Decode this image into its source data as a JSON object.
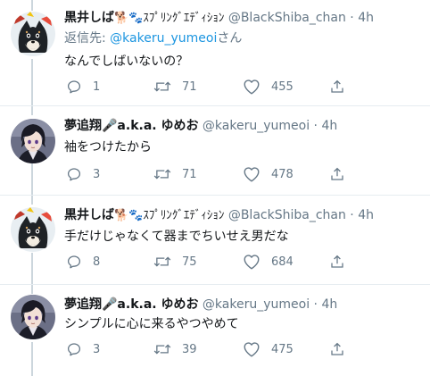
{
  "tweets": [
    {
      "name": "黒井しば",
      "badge": "🐕🐾ｽﾌﾟﾘﾝｸﾞｴﾃﾞｨｼｮﾝ",
      "handle": "@BlackShiba_chan",
      "dot": "·",
      "time": "4h",
      "replying_prefix": "返信先: ",
      "replying_to": "@kakeru_yumeoi",
      "replying_suffix": "さん",
      "text": "なんでしばいないの？",
      "replies": "1",
      "retweets": "71",
      "likes": "455",
      "avatar": "shiba-avatar"
    },
    {
      "name": "夢追翔🎤a.k.a. ゆめお",
      "handle": "@kakeru_yumeoi",
      "dot": "·",
      "time": "4h",
      "text": "袖をつけたから",
      "replies": "3",
      "retweets": "71",
      "likes": "478",
      "avatar": "dark-haired-character-avatar"
    },
    {
      "name": "黒井しば",
      "badge": "🐕🐾ｽﾌﾟﾘﾝｸﾞｴﾃﾞｨｼｮﾝ",
      "handle": "@BlackShiba_chan",
      "dot": "·",
      "time": "4h",
      "text": "手だけじゃなくて器までちいせえ男だな",
      "replies": "8",
      "retweets": "75",
      "likes": "684",
      "avatar": "shiba-avatar"
    },
    {
      "name": "夢追翔🎤a.k.a. ゆめお",
      "handle": "@kakeru_yumeoi",
      "dot": "·",
      "time": "4h",
      "text": "シンプルに心に来るやつやめて",
      "replies": "3",
      "retweets": "39",
      "likes": "475",
      "avatar": "dark-haired-character-avatar"
    }
  ],
  "colors": {
    "text": "#14171a",
    "muted": "#657786",
    "link": "#1b95e0",
    "thread_line": "#ccd6dd",
    "separator": "#e6ecf0"
  },
  "icons": [
    "reply-icon",
    "retweet-icon",
    "like-icon",
    "share-icon"
  ]
}
